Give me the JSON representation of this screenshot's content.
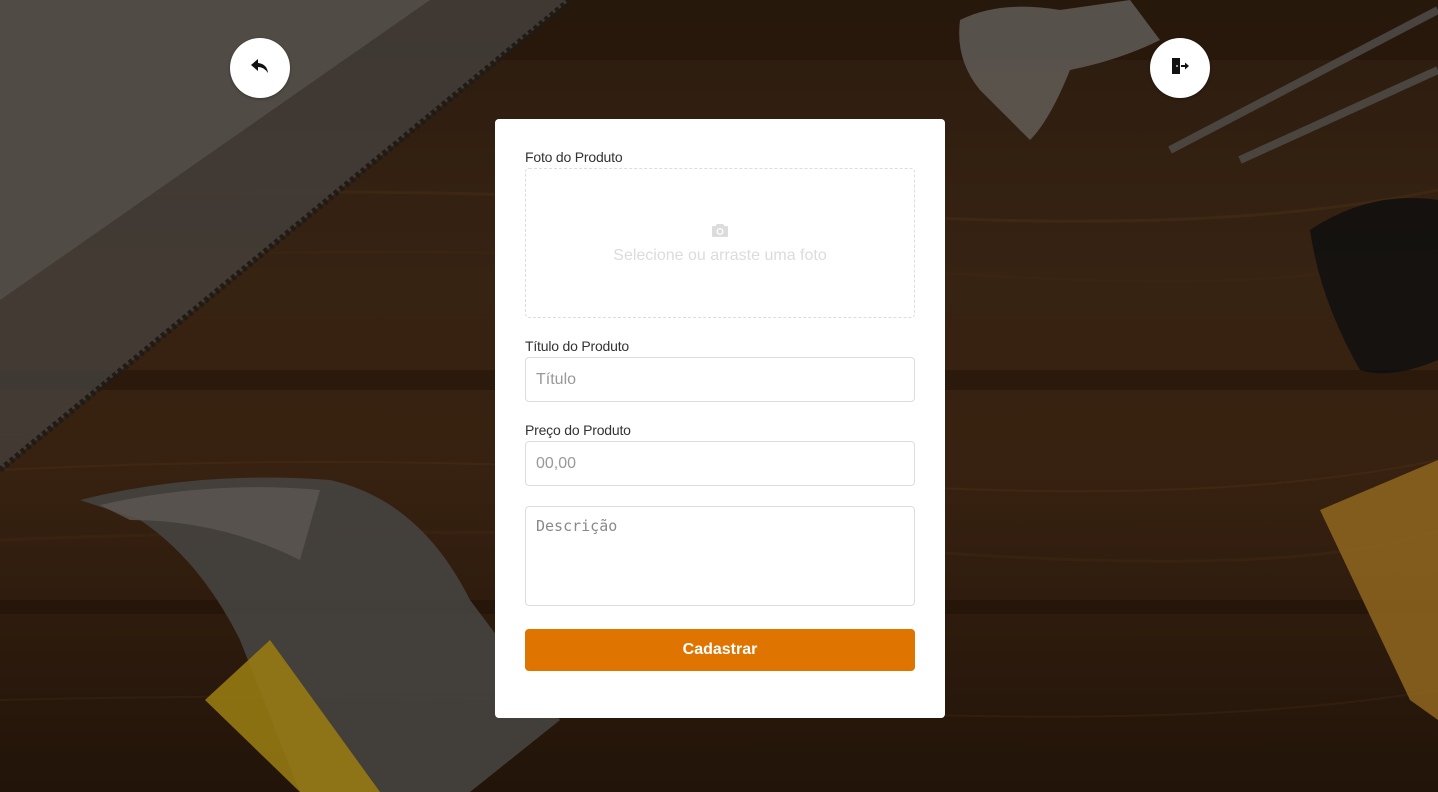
{
  "nav": {
    "back_icon": "reply-arrow-icon",
    "logout_icon": "sign-out-door-icon"
  },
  "form": {
    "photo_label": "Foto do Produto",
    "photo_placeholder": "Selecione ou arraste uma foto",
    "photo_icon": "camera-icon",
    "title_label": "Título do Produto",
    "title_placeholder": "Título",
    "price_label": "Preço do Produto",
    "price_placeholder": "00,00",
    "description_placeholder": "Descrição",
    "submit_label": "Cadastrar"
  },
  "colors": {
    "accent": "#e07400",
    "card": "#ffffff",
    "background": "#3a2515"
  }
}
